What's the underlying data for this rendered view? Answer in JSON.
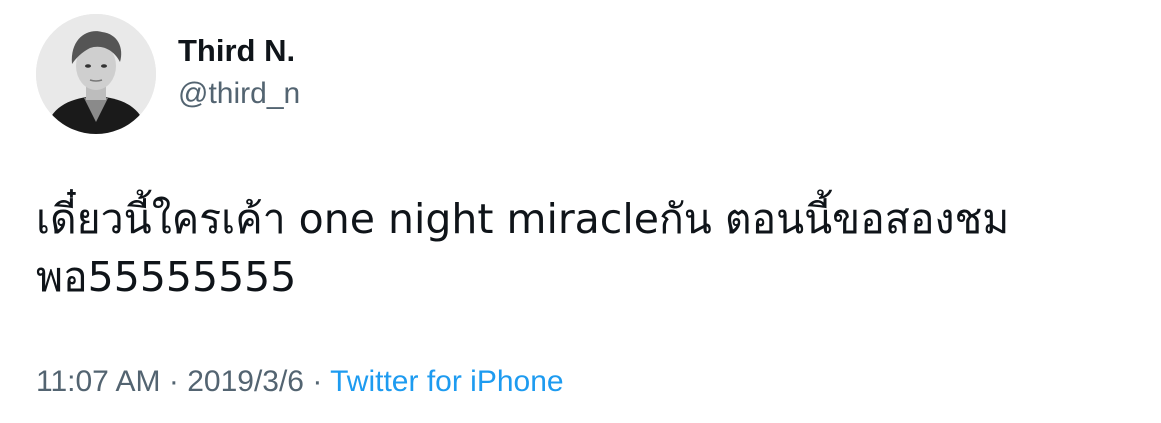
{
  "author": {
    "display_name": "Third N.",
    "handle": "@third_n"
  },
  "tweet": {
    "text_line1": "เดี๋ยวนี้ใครเค้า one night miracleกัน ตอนนี้ขอสองชม",
    "text_line2": "พอ55555555"
  },
  "meta": {
    "time": "11:07 AM",
    "separator": "·",
    "date": "2019/3/6",
    "source": "Twitter for iPhone",
    "source_color": "#1d9bf0"
  }
}
